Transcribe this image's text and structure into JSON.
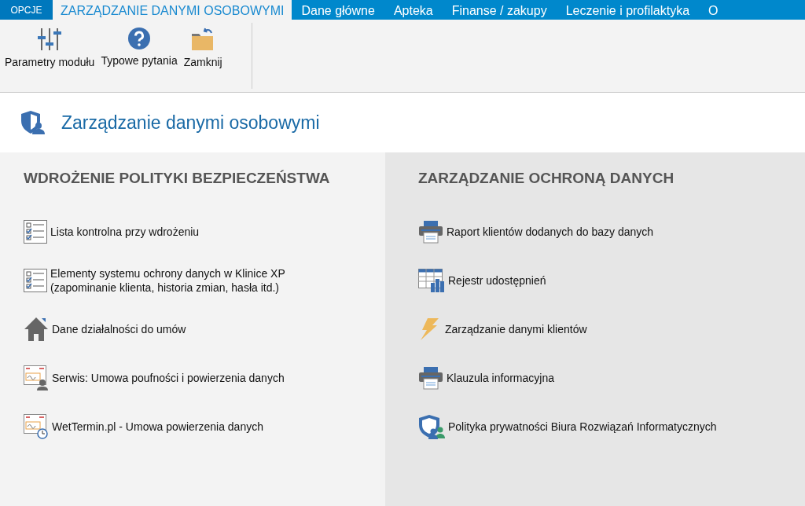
{
  "tabs": [
    {
      "label": "OPCJE",
      "kind": "file",
      "selected": false
    },
    {
      "label": "ZARZĄDZANIE DANYMI OSOBOWYMI",
      "kind": "tab",
      "selected": true
    },
    {
      "label": "Dane główne",
      "kind": "tab",
      "selected": false
    },
    {
      "label": "Apteka",
      "kind": "tab",
      "selected": false
    },
    {
      "label": "Finanse / zakupy",
      "kind": "tab",
      "selected": false
    },
    {
      "label": "Leczenie i profilaktyka",
      "kind": "tab",
      "selected": false
    },
    {
      "label": "O",
      "kind": "tab",
      "selected": false
    }
  ],
  "ribbon": [
    {
      "label": "Parametry modułu",
      "kind": "sliders"
    },
    {
      "label": "Typowe pytania",
      "kind": "help"
    },
    {
      "label": "Zamknij",
      "kind": "folder"
    }
  ],
  "page_title": "Zarządzanie danymi osobowymi",
  "sections": [
    {
      "heading": "WDROŻENIE POLITYKI BEZPIECZEŃSTWA",
      "items": [
        {
          "label": "Lista kontrolna przy wdrożeniu",
          "kind": "checklist"
        },
        {
          "label": "Elementy systemu ochrony danych w Klinice XP\n(zapominanie klienta, historia zmian, hasła itd.)",
          "kind": "checklist"
        },
        {
          "label": "Dane działalności do umów",
          "kind": "house"
        },
        {
          "label": "Serwis: Umowa poufności i powierzenia danych",
          "kind": "contract-person"
        },
        {
          "label": "WetTermin.pl - Umowa powierzenia danych",
          "kind": "contract-clock"
        }
      ]
    },
    {
      "heading": "ZARZĄDZANIE OCHRONĄ DANYCH",
      "items": [
        {
          "label": "Raport klientów dodanych do bazy danych",
          "kind": "printer"
        },
        {
          "label": "Rejestr udostępnień",
          "kind": "table"
        },
        {
          "label": "Zarządzanie danymi klientów",
          "kind": "bolt"
        },
        {
          "label": "Klauzula informacyjna",
          "kind": "printer"
        },
        {
          "label": "Polityka prywatności Biura Rozwiązań Informatycznych",
          "kind": "shield-users"
        }
      ]
    }
  ]
}
